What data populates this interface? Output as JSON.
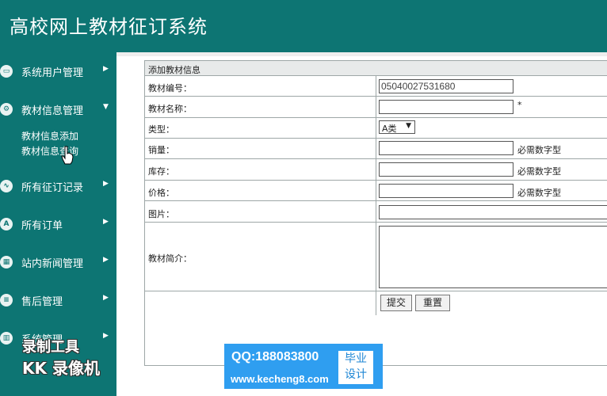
{
  "app": {
    "title": "高校网上教材征订系统"
  },
  "sidebar": {
    "items": [
      {
        "label": "系统用户管理",
        "icon": "monitor-icon",
        "arrow": "▶"
      },
      {
        "label": "教材信息管理",
        "icon": "user-gear-icon",
        "arrow": "▼"
      },
      {
        "label": "所有征订记录",
        "icon": "wave-icon",
        "arrow": "▶"
      },
      {
        "label": "所有订单",
        "icon": "app-icon",
        "arrow": "▶"
      },
      {
        "label": "站内新闻管理",
        "icon": "building-icon",
        "arrow": "▶"
      },
      {
        "label": "售后管理",
        "icon": "stack-icon",
        "arrow": "▶"
      },
      {
        "label": "系统管理",
        "icon": "chart-icon",
        "arrow": "▶"
      }
    ],
    "subitems": [
      {
        "label": "教材信息添加"
      },
      {
        "label": "教材信息查询"
      }
    ]
  },
  "form": {
    "caption": "添加教材信息",
    "fields": {
      "code": {
        "label": "教材编号：",
        "value": "05040027531680"
      },
      "name": {
        "label": "教材名称：",
        "value": "",
        "required": "*"
      },
      "type": {
        "label": "类型：",
        "value": "A类"
      },
      "sales": {
        "label": "销量：",
        "value": "",
        "hint": "必需数字型"
      },
      "stock": {
        "label": "库存：",
        "value": "",
        "hint": "必需数字型"
      },
      "price": {
        "label": "价格：",
        "value": "",
        "hint": "必需数字型"
      },
      "image": {
        "label": "图片：",
        "value": ""
      },
      "intro": {
        "label": "教材简介：",
        "value": ""
      }
    },
    "buttons": {
      "submit": "提交",
      "reset": "重置"
    }
  },
  "watermark": {
    "line1": "录制工具",
    "line2": "KK 录像机",
    "qq": "QQ:188083800",
    "website": "www.kecheng8.com",
    "badge_line1": "毕业",
    "badge_line2": "设计"
  },
  "colors": {
    "theme": "#0d7573",
    "border": "#9ea7a7",
    "watermark_bg": "#2f9ef0"
  }
}
